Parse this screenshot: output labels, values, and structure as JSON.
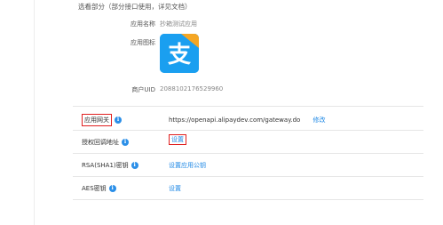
{
  "note": "选看部分（部分接口使用，详见文档）",
  "app_info": {
    "name_label": "应用名称",
    "name_value": "抄箱测试应用",
    "icon_label": "应用图标",
    "icon_glyph": "支",
    "uid_label": "商户UID",
    "uid_value": "2088102176529960"
  },
  "config": {
    "gateway_label": "应用网关",
    "gateway_value": "https://openapi.alipaydev.com/gateway.do",
    "gateway_action": "修改",
    "callback_label": "授权回调地址",
    "callback_action": "设置",
    "rsa_label": "RSA(SHA1)密钥",
    "rsa_action": "设置应用公钥",
    "aes_label": "AES密钥",
    "aes_action": "设置"
  },
  "colors": {
    "accent": "#1e88e5",
    "highlight": "#e02020",
    "icon_bg": "#1a9ff0"
  },
  "icons": {
    "info": "info-circle-icon",
    "app": "alipay-logo-icon"
  },
  "info_glyph": "i"
}
